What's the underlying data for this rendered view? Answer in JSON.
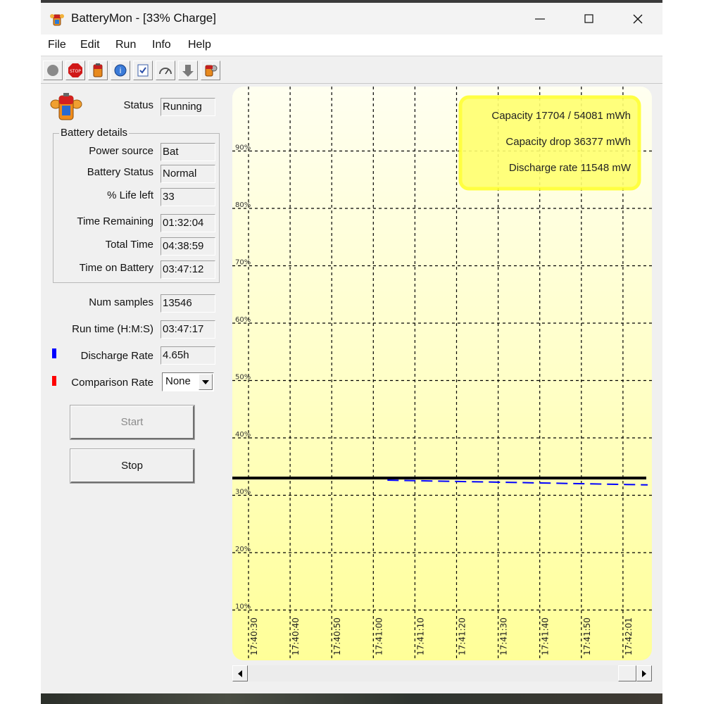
{
  "window": {
    "title": "BatteryMon - [33% Charge]"
  },
  "menu": [
    "File",
    "Edit",
    "Run",
    "Info",
    "Help"
  ],
  "toolbar": [
    {
      "icon": "gray-dot-icon"
    },
    {
      "icon": "stop-sign-icon"
    },
    {
      "icon": "battery-icon"
    },
    {
      "icon": "battery-info-icon"
    },
    {
      "icon": "checklist-icon"
    },
    {
      "icon": "gauge-icon"
    },
    {
      "icon": "arrow-down-icon"
    },
    {
      "icon": "battery-settings-icon"
    }
  ],
  "status": {
    "label": "Status",
    "value": "Running"
  },
  "battery_details": {
    "title": "Battery details",
    "rows": [
      {
        "label": "Power source",
        "value": "Bat"
      },
      {
        "label": "Battery Status",
        "value": "Normal"
      },
      {
        "label": "% Life left",
        "value": "33"
      },
      {
        "label": "Time Remaining",
        "value": "01:32:04"
      },
      {
        "label": "Total Time",
        "value": "04:38:59"
      },
      {
        "label": "Time on Battery",
        "value": "03:47:12"
      }
    ]
  },
  "num_samples": {
    "label": "Num samples",
    "value": "13546"
  },
  "run_time": {
    "label": "Run time (H:M:S)",
    "value": "03:47:17"
  },
  "discharge_rate": {
    "label": "Discharge Rate",
    "value": "4.65h",
    "color": "#0000ff"
  },
  "comparison_rate": {
    "label": "Comparison Rate",
    "value": "None",
    "color": "#ff0000"
  },
  "buttons": {
    "start": "Start",
    "stop": "Stop"
  },
  "info_box": {
    "line1": "Capacity 17704 / 54081 mWh",
    "line2": "Capacity drop 36377 mWh",
    "line3": "Discharge rate 11548 mW"
  },
  "chart_data": {
    "type": "line",
    "y_tick_labels": [
      "90%",
      "80%",
      "70%",
      "60%",
      "50%",
      "40%",
      "30%",
      "20%",
      "10%"
    ],
    "x_tick_labels": [
      "17:40:30",
      "17:40:40",
      "17:40:50",
      "17:41:00",
      "17:41:10",
      "17:41:20",
      "17:41:30",
      "17:41:40",
      "17:41:50",
      "17:42:01"
    ],
    "series": [
      {
        "color": "#000000",
        "style": "solid",
        "y": 33
      },
      {
        "color": "#0000ff",
        "style": "dashed",
        "start_x": "17:41:00",
        "y_start": 33,
        "y_end": 32.3
      }
    ],
    "background": "#ffffaa",
    "grid": true
  }
}
